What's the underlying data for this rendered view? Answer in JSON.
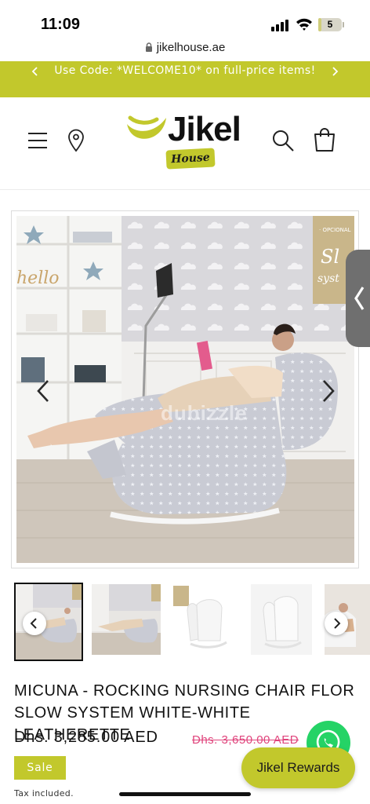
{
  "status_bar": {
    "time": "11:09",
    "battery_label": "5",
    "battery_level": 0.05,
    "icons": [
      "signal-icon",
      "wifi-icon",
      "battery-icon"
    ]
  },
  "browser": {
    "url": "jikelhouse.ae"
  },
  "announcement": {
    "text": "Use Code: *WELCOME10* on full-price items!"
  },
  "header": {
    "logo_word": "Jikel",
    "logo_tagline": "House",
    "icons": [
      "hamburger-menu-icon",
      "location-pin-icon",
      "search-icon",
      "shopping-bag-icon"
    ]
  },
  "gallery": {
    "watermark": "dubizzle",
    "thumbnail_count": 5,
    "active_index": 0
  },
  "product": {
    "title": "MICUNA - ROCKING NURSING CHAIR FLOR SLOW SYSTEM WHITE-WHITE LEATHERETTE",
    "price": "Dhs. 3,285.00 AED",
    "compare_price": "Dhs. 3,650.00 AED",
    "badge": "Sale",
    "tax_note": "Tax included."
  },
  "floating": {
    "rewards_label": "Jikel Rewards"
  },
  "colors": {
    "brand_green": "#c2c82c",
    "sale_pink": "#e0447c",
    "whatsapp_green": "#25d366"
  }
}
